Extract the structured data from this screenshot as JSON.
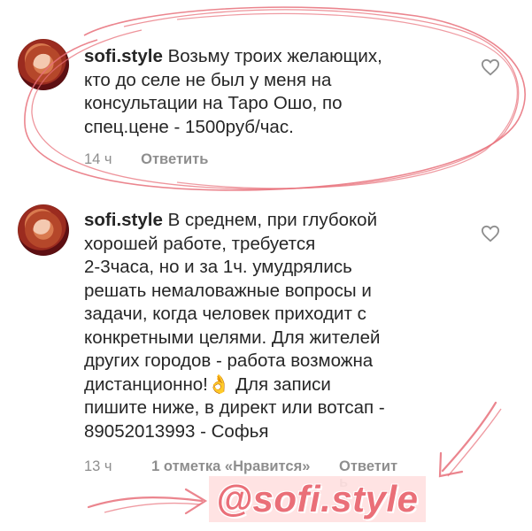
{
  "comments": [
    {
      "username": "sofi.style",
      "text": "Возьму троих желающих,\nкто до селе не был у меня на\nконсультации на Таро Ошо, по\nспец.цене - 1500руб/час.",
      "time": "14 ч",
      "reply": "Ответить",
      "likes": ""
    },
    {
      "username": "sofi.style",
      "text": "В среднем, при глубокой\nхорошей работе, требуется\n2-3часа, но и за 1ч. умудрялись\nрешать немаловажные вопросы и\nзадачи, когда человек приходит с\nконкретными целями.  Для жителей\nдругих городов - работа возможна\nдистанционно!👌 Для записи\nпишите ниже, в директ или вотсап -\n89052013993 - Софья",
      "time": "13 ч",
      "likes": "1 отметка «Нравится»",
      "reply": "Ответит\nь"
    }
  ],
  "watermark": {
    "handle": "@sofi.style"
  },
  "colors": {
    "annotation": "#e8707a",
    "meta": "#8e8e8e",
    "text": "#262626"
  },
  "icons": {
    "like": "heart-outline-icon"
  }
}
